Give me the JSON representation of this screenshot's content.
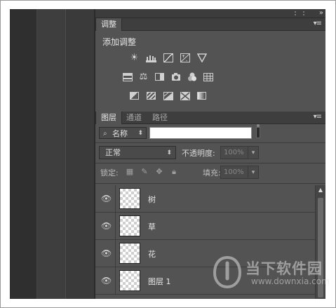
{
  "adjustments_panel": {
    "tab_label": "调整",
    "menu_icon": "panel-menu-icon",
    "title": "添加调整",
    "icons": [
      [
        "brightness-contrast-icon",
        "levels-icon",
        "curves-icon",
        "exposure-icon",
        "vibrance-icon"
      ],
      [
        "hue-saturation-icon",
        "color-balance-icon",
        "black-white-icon",
        "photo-filter-icon",
        "channel-mixer-icon",
        "color-lookup-icon"
      ],
      [
        "invert-icon",
        "posterize-icon",
        "threshold-icon",
        "selective-color-icon",
        "gradient-map-icon"
      ]
    ]
  },
  "layers_panel": {
    "tabs": [
      {
        "label": "图层",
        "active": true
      },
      {
        "label": "通道",
        "active": false
      },
      {
        "label": "路径",
        "active": false
      }
    ],
    "filter": {
      "kind_label": "名称",
      "value": ""
    },
    "blend_mode": "正常",
    "opacity_label": "不透明度:",
    "opacity_value": "100%",
    "lock_label": "锁定:",
    "fill_label": "填充:",
    "fill_value": "100%",
    "layers": [
      {
        "name": "树",
        "visible": true
      },
      {
        "name": "草",
        "visible": true
      },
      {
        "name": "花",
        "visible": true
      },
      {
        "name": "图层 1",
        "visible": true
      }
    ]
  },
  "watermark": {
    "brand": "当下软件园",
    "url": "www.downxia.com"
  }
}
